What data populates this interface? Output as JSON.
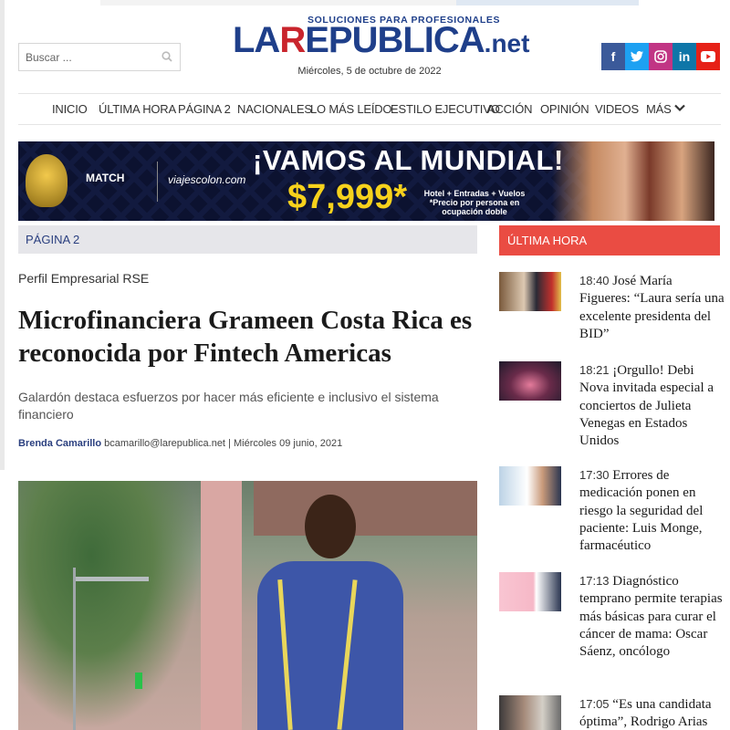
{
  "search": {
    "placeholder": "Buscar ..."
  },
  "header": {
    "logo_tagline": "SOLUCIONES PARA PROFESIONALES",
    "logo_main_1": "LA",
    "logo_main_r": "R",
    "logo_main_2": "EPUBLICA",
    "logo_suffix": ".net",
    "date": "Miércoles, 5 de octubre de 2022"
  },
  "social": [
    {
      "icon": "facebook-icon",
      "glyph": "f",
      "color": "#3b5a9a"
    },
    {
      "icon": "twitter-icon",
      "glyph": "t",
      "color": "#1da1f2"
    },
    {
      "icon": "instagram-icon",
      "glyph": "◎",
      "color": "#c13584"
    },
    {
      "icon": "linkedin-icon",
      "glyph": "in",
      "color": "#0e76a8"
    },
    {
      "icon": "youtube-icon",
      "glyph": "▶",
      "color": "#e62117"
    }
  ],
  "nav": {
    "items": [
      "INICIO",
      "ÚLTIMA HORA",
      "PÁGINA 2",
      "NACIONALES",
      "LO MÁS LEÍDO",
      "ESTILO EJECUTIVO",
      "ACCIÓN",
      "OPINIÓN",
      "VIDEOS",
      "MÁS"
    ]
  },
  "banner": {
    "match_label": "MATCH",
    "viajes_label": "viajescolon.com",
    "headline": "¡VAMOS AL MUNDIAL!",
    "price": "$7,999*",
    "details_line1": "Hotel + Entradas + Vuelos",
    "details_line2": "*Precio por persona en ocupación doble"
  },
  "section": {
    "left_label": "PÁGINA 2",
    "right_label": "ÚLTIMA HORA"
  },
  "article": {
    "kicker": "Perfil Empresarial RSE",
    "title": "Microfinanciera Grameen Costa Rica es reconocida por Fintech Americas",
    "subtitle": "Galardón destaca esfuerzos por hacer más eficiente e inclusivo el sistema financiero",
    "author": "Brenda Camarillo",
    "byline_rest": " bcamarillo@larepublica.net | Miércoles 09 junio, 2021"
  },
  "latest": [
    {
      "time": "18:40",
      "headline": "José María Figueres: “Laura sería una excelente presidenta del BID”"
    },
    {
      "time": "18:21",
      "headline": "¡Orgullo! Debi Nova invitada especial a conciertos de Julieta Venegas en Estados Unidos"
    },
    {
      "time": "17:30",
      "headline": "Errores de medicación ponen en riesgo la seguridad del paciente: Luis Monge, farmacéutico"
    },
    {
      "time": "17:13",
      "headline": "Diagnóstico temprano permite terapias más básicas para curar el cáncer de mama: Oscar Sáenz, oncólogo"
    },
    {
      "time": "17:05",
      "headline": "“Es una candidata óptima”, Rodrigo Arias"
    }
  ]
}
